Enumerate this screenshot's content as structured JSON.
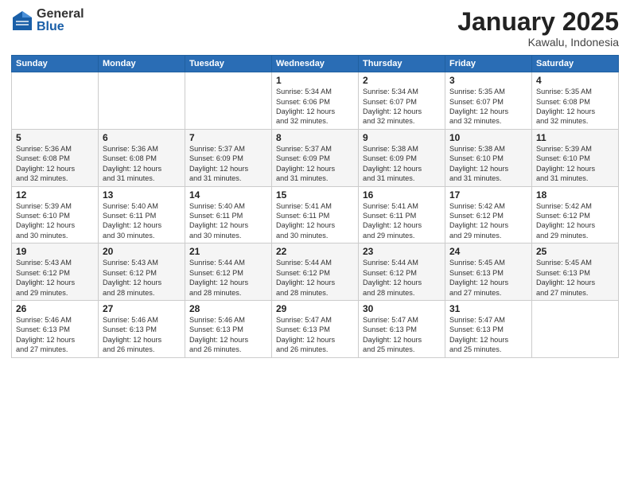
{
  "logo": {
    "general": "General",
    "blue": "Blue"
  },
  "title": "January 2025",
  "subtitle": "Kawalu, Indonesia",
  "days_header": [
    "Sunday",
    "Monday",
    "Tuesday",
    "Wednesday",
    "Thursday",
    "Friday",
    "Saturday"
  ],
  "weeks": [
    [
      {
        "day": "",
        "info": ""
      },
      {
        "day": "",
        "info": ""
      },
      {
        "day": "",
        "info": ""
      },
      {
        "day": "1",
        "info": "Sunrise: 5:34 AM\nSunset: 6:06 PM\nDaylight: 12 hours\nand 32 minutes."
      },
      {
        "day": "2",
        "info": "Sunrise: 5:34 AM\nSunset: 6:07 PM\nDaylight: 12 hours\nand 32 minutes."
      },
      {
        "day": "3",
        "info": "Sunrise: 5:35 AM\nSunset: 6:07 PM\nDaylight: 12 hours\nand 32 minutes."
      },
      {
        "day": "4",
        "info": "Sunrise: 5:35 AM\nSunset: 6:08 PM\nDaylight: 12 hours\nand 32 minutes."
      }
    ],
    [
      {
        "day": "5",
        "info": "Sunrise: 5:36 AM\nSunset: 6:08 PM\nDaylight: 12 hours\nand 32 minutes."
      },
      {
        "day": "6",
        "info": "Sunrise: 5:36 AM\nSunset: 6:08 PM\nDaylight: 12 hours\nand 31 minutes."
      },
      {
        "day": "7",
        "info": "Sunrise: 5:37 AM\nSunset: 6:09 PM\nDaylight: 12 hours\nand 31 minutes."
      },
      {
        "day": "8",
        "info": "Sunrise: 5:37 AM\nSunset: 6:09 PM\nDaylight: 12 hours\nand 31 minutes."
      },
      {
        "day": "9",
        "info": "Sunrise: 5:38 AM\nSunset: 6:09 PM\nDaylight: 12 hours\nand 31 minutes."
      },
      {
        "day": "10",
        "info": "Sunrise: 5:38 AM\nSunset: 6:10 PM\nDaylight: 12 hours\nand 31 minutes."
      },
      {
        "day": "11",
        "info": "Sunrise: 5:39 AM\nSunset: 6:10 PM\nDaylight: 12 hours\nand 31 minutes."
      }
    ],
    [
      {
        "day": "12",
        "info": "Sunrise: 5:39 AM\nSunset: 6:10 PM\nDaylight: 12 hours\nand 30 minutes."
      },
      {
        "day": "13",
        "info": "Sunrise: 5:40 AM\nSunset: 6:11 PM\nDaylight: 12 hours\nand 30 minutes."
      },
      {
        "day": "14",
        "info": "Sunrise: 5:40 AM\nSunset: 6:11 PM\nDaylight: 12 hours\nand 30 minutes."
      },
      {
        "day": "15",
        "info": "Sunrise: 5:41 AM\nSunset: 6:11 PM\nDaylight: 12 hours\nand 30 minutes."
      },
      {
        "day": "16",
        "info": "Sunrise: 5:41 AM\nSunset: 6:11 PM\nDaylight: 12 hours\nand 29 minutes."
      },
      {
        "day": "17",
        "info": "Sunrise: 5:42 AM\nSunset: 6:12 PM\nDaylight: 12 hours\nand 29 minutes."
      },
      {
        "day": "18",
        "info": "Sunrise: 5:42 AM\nSunset: 6:12 PM\nDaylight: 12 hours\nand 29 minutes."
      }
    ],
    [
      {
        "day": "19",
        "info": "Sunrise: 5:43 AM\nSunset: 6:12 PM\nDaylight: 12 hours\nand 29 minutes."
      },
      {
        "day": "20",
        "info": "Sunrise: 5:43 AM\nSunset: 6:12 PM\nDaylight: 12 hours\nand 28 minutes."
      },
      {
        "day": "21",
        "info": "Sunrise: 5:44 AM\nSunset: 6:12 PM\nDaylight: 12 hours\nand 28 minutes."
      },
      {
        "day": "22",
        "info": "Sunrise: 5:44 AM\nSunset: 6:12 PM\nDaylight: 12 hours\nand 28 minutes."
      },
      {
        "day": "23",
        "info": "Sunrise: 5:44 AM\nSunset: 6:12 PM\nDaylight: 12 hours\nand 28 minutes."
      },
      {
        "day": "24",
        "info": "Sunrise: 5:45 AM\nSunset: 6:13 PM\nDaylight: 12 hours\nand 27 minutes."
      },
      {
        "day": "25",
        "info": "Sunrise: 5:45 AM\nSunset: 6:13 PM\nDaylight: 12 hours\nand 27 minutes."
      }
    ],
    [
      {
        "day": "26",
        "info": "Sunrise: 5:46 AM\nSunset: 6:13 PM\nDaylight: 12 hours\nand 27 minutes."
      },
      {
        "day": "27",
        "info": "Sunrise: 5:46 AM\nSunset: 6:13 PM\nDaylight: 12 hours\nand 26 minutes."
      },
      {
        "day": "28",
        "info": "Sunrise: 5:46 AM\nSunset: 6:13 PM\nDaylight: 12 hours\nand 26 minutes."
      },
      {
        "day": "29",
        "info": "Sunrise: 5:47 AM\nSunset: 6:13 PM\nDaylight: 12 hours\nand 26 minutes."
      },
      {
        "day": "30",
        "info": "Sunrise: 5:47 AM\nSunset: 6:13 PM\nDaylight: 12 hours\nand 25 minutes."
      },
      {
        "day": "31",
        "info": "Sunrise: 5:47 AM\nSunset: 6:13 PM\nDaylight: 12 hours\nand 25 minutes."
      },
      {
        "day": "",
        "info": ""
      }
    ]
  ]
}
